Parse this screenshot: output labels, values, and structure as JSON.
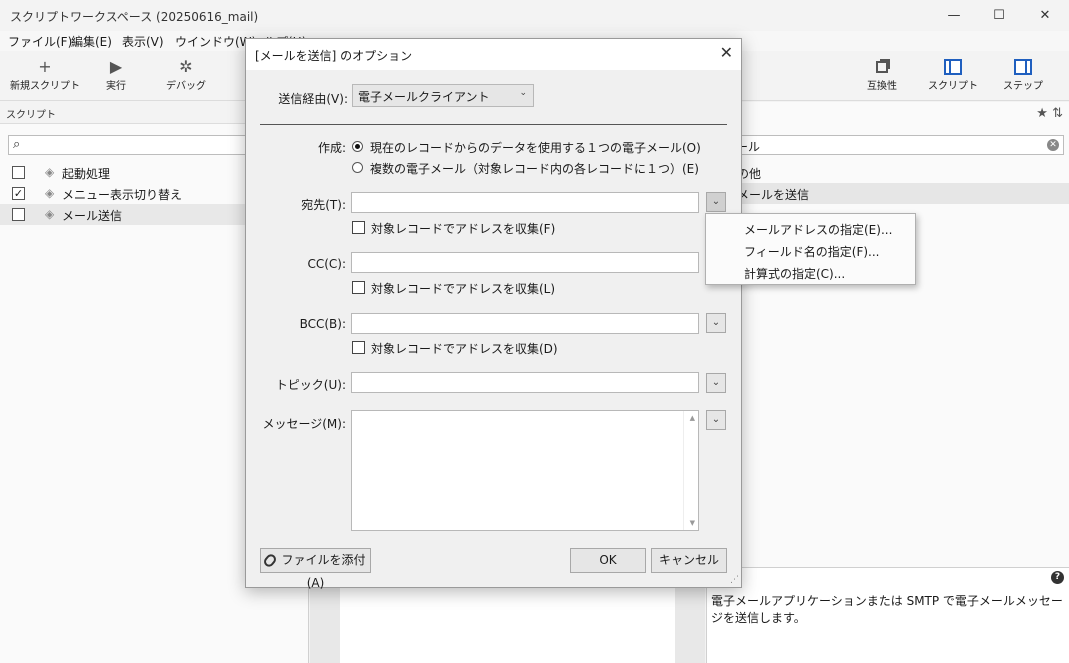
{
  "window": {
    "title": "スクリプトワークスペース (20250616_mail)",
    "controls": {
      "minimize": "—",
      "maximize": "☐",
      "close": "✕"
    }
  },
  "menubar": [
    "ファイル(F)",
    "編集(E)",
    "表示(V)",
    "ウインドウ(W)",
    "ヘルプ(H)"
  ],
  "toolbar": {
    "new_script": "新規スクリプト",
    "run": "実行",
    "debug": "デバッグ",
    "compat": "互換性",
    "script": "スクリプト",
    "step": "ステップ"
  },
  "left_pane": {
    "header": "スクリプト",
    "search_placeholder": "",
    "scripts": [
      {
        "label": "起動処理",
        "checked": false
      },
      {
        "label": "メニュー表示切り替え",
        "checked": true
      },
      {
        "label": "メール送信",
        "checked": false
      }
    ]
  },
  "right_pane": {
    "search_value": "ール",
    "items": [
      "の他",
      "メールを送信"
    ],
    "description": "電子メールアプリケーションまたは SMTP で電子メールメッセージを送信します。",
    "help": "?"
  },
  "dialog": {
    "title": "[メールを送信] のオプション",
    "close": "✕",
    "send_via_label": "送信経由(V):",
    "send_via_value": "電子メールクライアント",
    "create_label": "作成:",
    "create_options": [
      {
        "label": "現在のレコードからのデータを使用する１つの電子メール(O)",
        "selected": true
      },
      {
        "label": "複数の電子メール（対象レコード内の各レコードに１つ）(E)",
        "selected": false
      }
    ],
    "to_label": "宛先(T):",
    "cc_label": "CC(C):",
    "bcc_label": "BCC(B):",
    "subject_label": "トピック(U):",
    "message_label": "メッセージ(M):",
    "collect_to": "対象レコードでアドレスを収集(F)",
    "collect_cc": "対象レコードでアドレスを収集(L)",
    "collect_bcc": "対象レコードでアドレスを収集(D)",
    "attach_button": "ファイルを添付(A)",
    "ok_button": "OK",
    "cancel_button": "キャンセル"
  },
  "popup_menu": [
    "メールアドレスの指定(E)...",
    "フィールド名の指定(F)...",
    "計算式の指定(C)..."
  ]
}
